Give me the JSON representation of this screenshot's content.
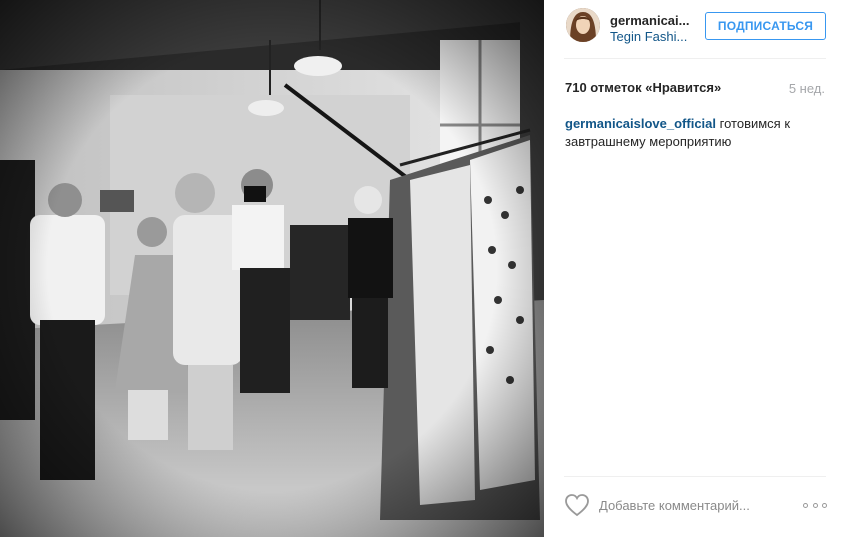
{
  "post": {
    "photo_alt": "",
    "username": "germanicai...",
    "location": "Tegin Fashi...",
    "follow_label": "ПОДПИСАТЬСЯ",
    "likes": "710 отметок «Нравится»",
    "time_ago": "5 нед.",
    "caption_user": "germanicaislove_official",
    "caption_text": " готовимся к завтрашнему мероприятию",
    "comment_placeholder": "Добавьте комментарий..."
  },
  "icons": {
    "avatar": "avatar-icon",
    "like": "heart-icon",
    "more": "more-options-icon"
  },
  "colors": {
    "link": "#125688",
    "follow": "#3897f0",
    "muted": "#a5a7aa"
  }
}
